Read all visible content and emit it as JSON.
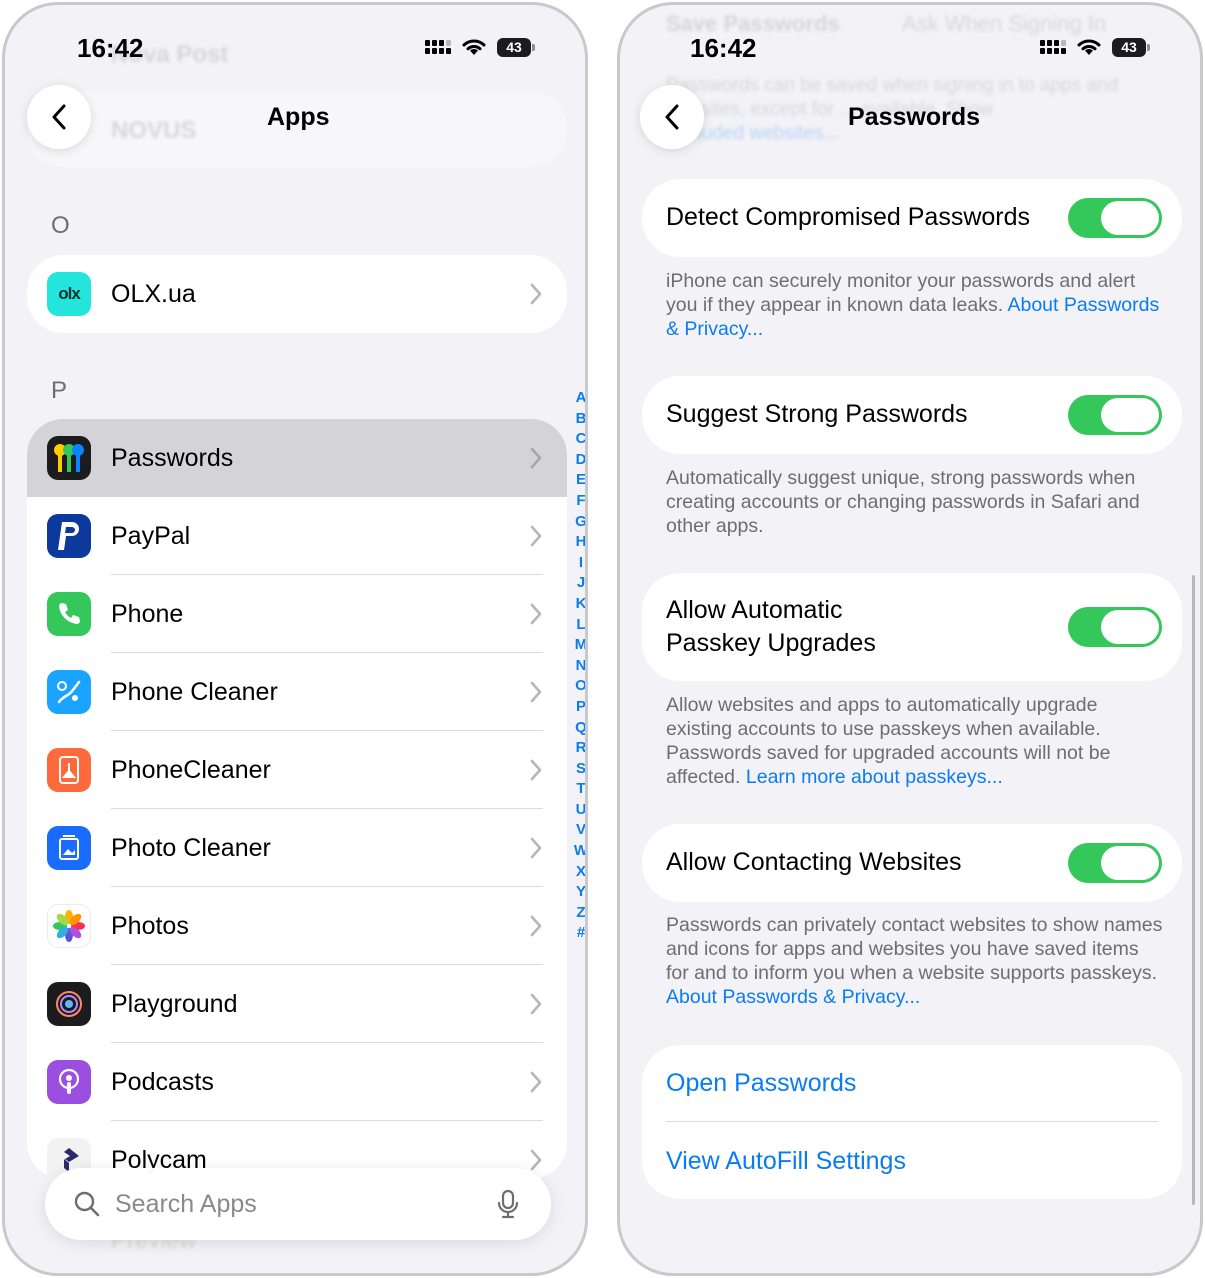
{
  "left": {
    "status": {
      "time": "16:42",
      "battery": "43"
    },
    "nav": {
      "title": "Apps"
    },
    "ghost": {
      "top_text": "Nova Post",
      "novus": "NOVUS",
      "bottom_text": "Preview"
    },
    "sections": [
      {
        "letter": "O",
        "items": [
          {
            "label": "OLX.ua",
            "icon": "olx-icon",
            "icon_text": "olx"
          }
        ]
      },
      {
        "letter": "P",
        "items": [
          {
            "label": "Passwords",
            "icon": "passwords-icon",
            "selected": true
          },
          {
            "label": "PayPal",
            "icon": "paypal-icon"
          },
          {
            "label": "Phone",
            "icon": "phone-icon"
          },
          {
            "label": "Phone Cleaner",
            "icon": "phone-cleaner-icon"
          },
          {
            "label": "PhoneCleaner",
            "icon": "phonecleaner-icon"
          },
          {
            "label": "Photo Cleaner",
            "icon": "photo-cleaner-icon"
          },
          {
            "label": "Photos",
            "icon": "photos-icon"
          },
          {
            "label": "Playground",
            "icon": "playground-icon"
          },
          {
            "label": "Podcasts",
            "icon": "podcasts-icon"
          },
          {
            "label": "Polycam",
            "icon": "polycam-icon"
          }
        ]
      }
    ],
    "index_letters": [
      "A",
      "B",
      "C",
      "D",
      "E",
      "F",
      "G",
      "H",
      "I",
      "J",
      "K",
      "L",
      "M",
      "N",
      "O",
      "P",
      "Q",
      "R",
      "S",
      "T",
      "U",
      "V",
      "W",
      "X",
      "Y",
      "Z",
      "#"
    ],
    "search": {
      "placeholder": "Search Apps"
    }
  },
  "right": {
    "status": {
      "time": "16:42",
      "battery": "43"
    },
    "nav": {
      "title": "Passwords"
    },
    "ghost": {
      "line1_left": "Save Passwords",
      "line1_right": "Ask When Signing In",
      "line2": "Passwords can be saved when signing in to apps and",
      "line3": "websites, except for ... available. Show",
      "line4": "Excluded websites..."
    },
    "toggles": [
      {
        "label": "Detect Compromised Passwords",
        "on": true,
        "desc": "iPhone can securely monitor your passwords and alert you if they appear in known data leaks. ",
        "link": "About Passwords & Privacy..."
      },
      {
        "label": "Suggest Strong Passwords",
        "on": true,
        "desc": "Automatically suggest unique, strong passwords when creating accounts or changing passwords in Safari and other apps.",
        "link": ""
      },
      {
        "label_line1": "Allow Automatic",
        "label_line2": "Passkey Upgrades",
        "on": true,
        "desc": "Allow websites and apps to automatically upgrade existing accounts to use passkeys when available. Passwords saved for upgraded accounts will not be affected. ",
        "link": "Learn more about passkeys..."
      },
      {
        "label": "Allow Contacting Websites",
        "on": true,
        "desc": "Passwords can privately contact websites to show names and icons for apps and websites you have saved items for and to inform you when a website supports passkeys. ",
        "link": "About Passwords & Privacy..."
      }
    ],
    "actions": {
      "open": "Open Passwords",
      "autofill": "View AutoFill Settings"
    }
  },
  "colors": {
    "accent": "#0a7cf2",
    "toggle_on": "#34c759",
    "background": "#f2f2f7",
    "selected_row": "#d4d4d8"
  }
}
